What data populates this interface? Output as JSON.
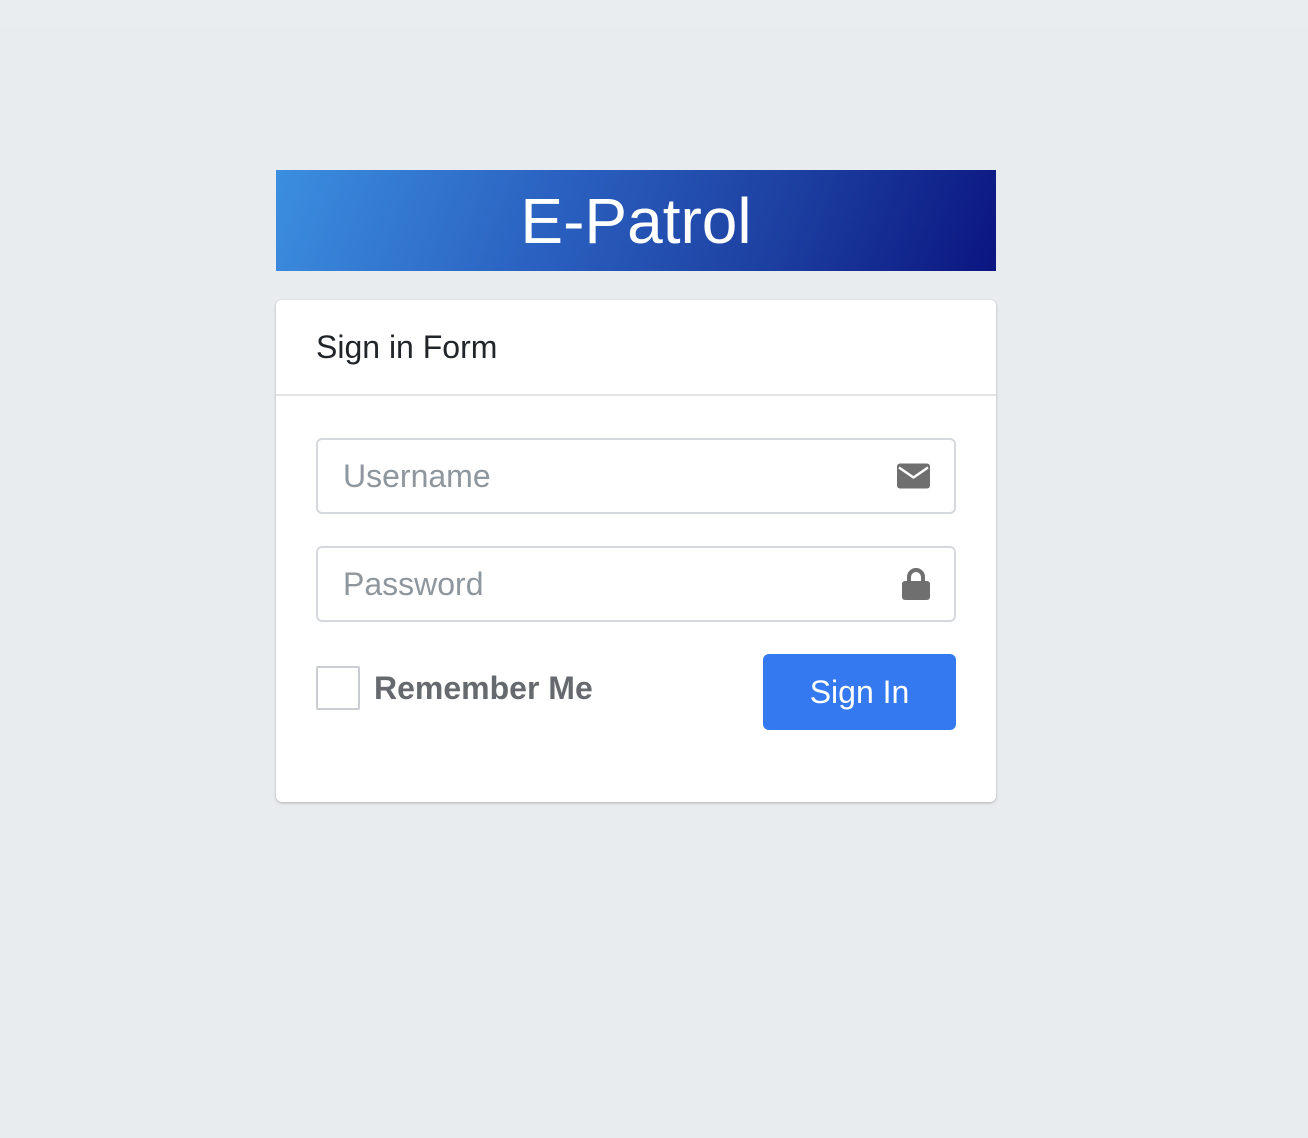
{
  "brand": {
    "title": "E-Patrol"
  },
  "form": {
    "title": "Sign in Form",
    "username": {
      "placeholder": "Username",
      "value": "",
      "icon": "envelope-icon"
    },
    "password": {
      "placeholder": "Password",
      "value": "",
      "icon": "lock-icon"
    },
    "remember": {
      "label": "Remember Me",
      "checked": false
    },
    "submit_label": "Sign In"
  },
  "colors": {
    "page_background": "#e9ecef",
    "banner_gradient_start": "#3b8ee0",
    "banner_gradient_end": "#0b1581",
    "primary_button": "#3479f0",
    "icon": "#6f6f6f"
  }
}
